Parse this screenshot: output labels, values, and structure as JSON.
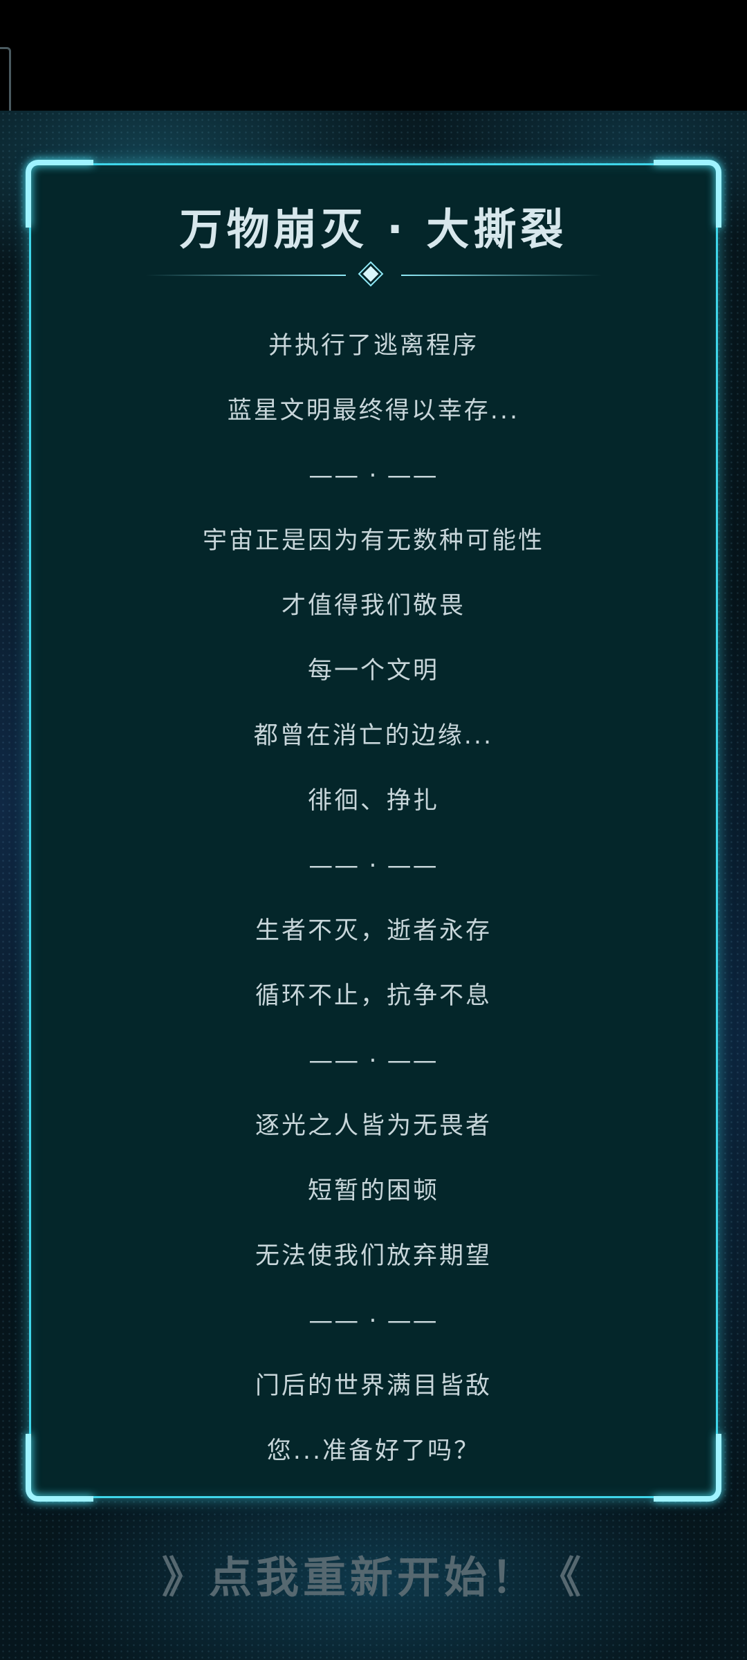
{
  "dialog": {
    "title": "万物崩灭 · 大撕裂",
    "lines": [
      "并执行了逃离程序",
      "蓝星文明最终得以幸存...",
      "—— · ——",
      "宇宙正是因为有无数种可能性",
      "才值得我们敬畏",
      "每一个文明",
      "都曾在消亡的边缘...",
      "徘徊、挣扎",
      "—— · ——",
      "生者不灭，逝者永存",
      "循环不止，抗争不息",
      "—— · ——",
      "逐光之人皆为无畏者",
      "短暂的困顿",
      "无法使我们放弃期望",
      "—— · ——",
      "门后的世界满目皆敌",
      "您...准备好了吗？"
    ]
  },
  "restart": {
    "label": "》点我重新开始！《"
  },
  "colors": {
    "frame": "#3fd6ea",
    "panel": "#04262a",
    "text": "#c8d6da",
    "restart": "#566870"
  }
}
